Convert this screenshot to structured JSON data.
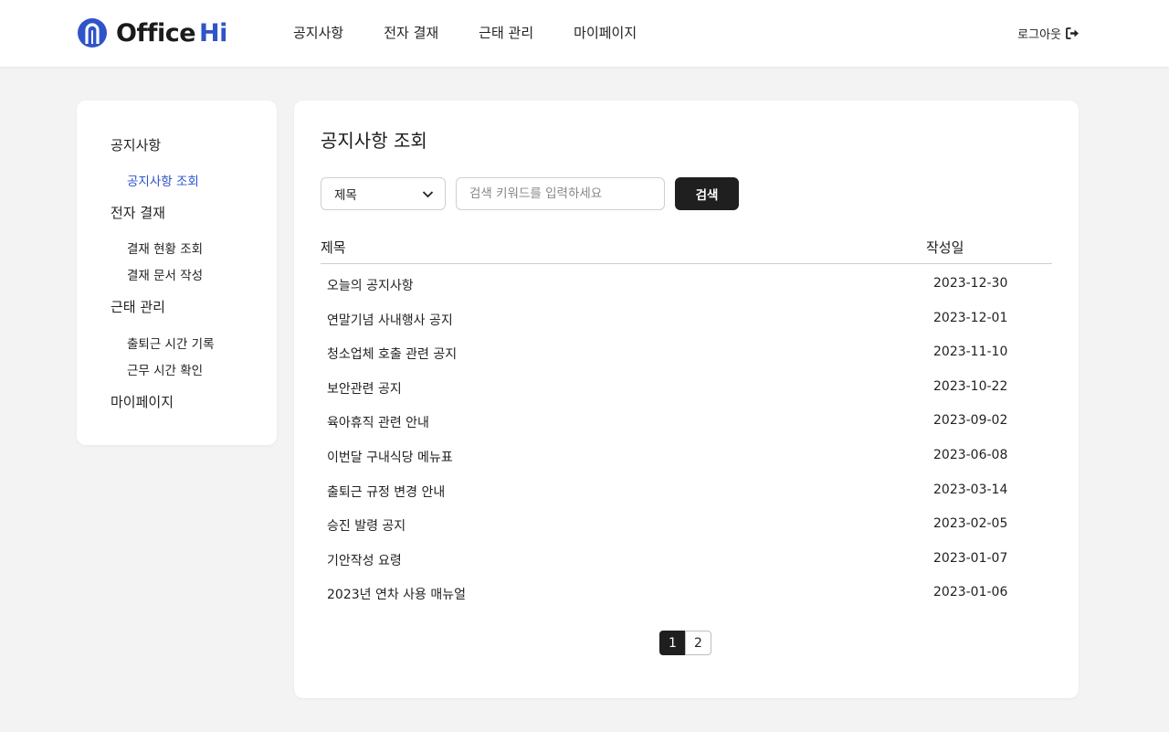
{
  "header": {
    "logo_text": "Office",
    "logo_accent": "Hi",
    "nav": [
      "공지사항",
      "전자 결재",
      "근태 관리",
      "마이페이지"
    ],
    "logout_label": "로그아웃",
    "logout_icon": "sign-out-icon",
    "brand_color": "#2f54c9"
  },
  "sidebar": {
    "groups": [
      {
        "title": "공지사항",
        "items": [
          "공지사항 조회"
        ]
      },
      {
        "title": "전자 결재",
        "items": [
          "결재 현황 조회",
          "결재 문서 작성"
        ]
      },
      {
        "title": "근태 관리",
        "items": [
          "출퇴근 시간 기록",
          "근무 시간 확인"
        ]
      },
      {
        "title": "마이페이지",
        "items": []
      }
    ],
    "active_item": "공지사항 조회"
  },
  "main": {
    "title": "공지사항 조회",
    "filter": {
      "selected": "제목",
      "icon": "chevron-down-icon"
    },
    "search": {
      "placeholder": "검색 키워드를 입력하세요",
      "value": "",
      "button_label": "검색"
    },
    "columns": [
      "제목",
      "작성일"
    ],
    "rows": [
      {
        "title": "오늘의 공지사항",
        "date": "2023-12-30"
      },
      {
        "title": "연말기념 사내행사 공지",
        "date": "2023-12-01"
      },
      {
        "title": "청소업체 호출 관련 공지",
        "date": "2023-11-10"
      },
      {
        "title": "보안관련 공지",
        "date": "2023-10-22"
      },
      {
        "title": "육아휴직 관련 안내",
        "date": "2023-09-02"
      },
      {
        "title": "이번달 구내식당 메뉴표",
        "date": "2023-06-08"
      },
      {
        "title": "출퇴근 규정 변경 안내",
        "date": "2023-03-14"
      },
      {
        "title": "승진 발령 공지",
        "date": "2023-02-05"
      },
      {
        "title": "기안작성 요령",
        "date": "2023-01-07"
      },
      {
        "title": "2023년 연차 사용 매뉴얼",
        "date": "2023-01-06"
      }
    ],
    "pagination": {
      "pages": [
        "1",
        "2"
      ],
      "current": "1"
    }
  }
}
